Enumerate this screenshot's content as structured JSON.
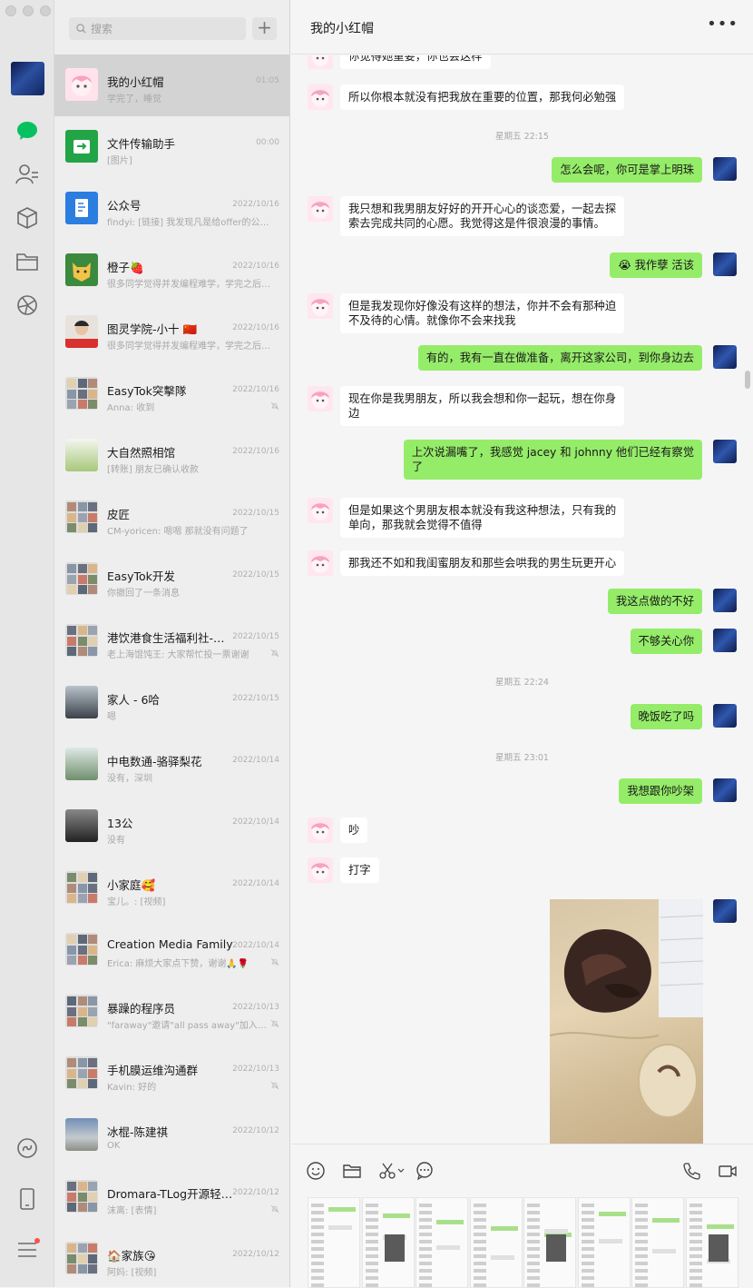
{
  "search": {
    "placeholder": "搜索"
  },
  "chats": [
    {
      "name": "我的小红帽",
      "time": "01:05",
      "preview": "学完了，睡觉",
      "selected": true,
      "muted": false,
      "avatar": "pink-girl"
    },
    {
      "name": "文件传输助手",
      "time": "00:00",
      "preview": "[图片]",
      "muted": false,
      "avatar": "file-transfer"
    },
    {
      "name": "公众号",
      "time": "2022/10/16",
      "preview": "findyi: [链接] 我发现凡是给offer的公司,...",
      "muted": false,
      "avatar": "official-account"
    },
    {
      "name": "橙子🍓",
      "time": "2022/10/16",
      "preview": "很多同学觉得并发编程难学，学完之后工作...",
      "muted": false,
      "avatar": "tomcat"
    },
    {
      "name": "图灵学院-小十 🇨🇳",
      "time": "2022/10/16",
      "preview": "很多同学觉得并发编程难学，学完之后工作...",
      "muted": false,
      "avatar": "person-red"
    },
    {
      "name": "EasyTok突擊隊",
      "time": "2022/10/16",
      "preview": "Anna: 收到",
      "muted": true,
      "avatar": "group"
    },
    {
      "name": "大自然照相馆",
      "time": "2022/10/16",
      "preview": "[转账] 朋友已确认收款",
      "muted": false,
      "avatar": "plant"
    },
    {
      "name": "皮匠",
      "time": "2022/10/15",
      "preview": "CM-yoricen: 嗯嗯  那就没有问题了",
      "muted": false,
      "avatar": "group"
    },
    {
      "name": "EasyTok开发",
      "time": "2022/10/15",
      "preview": "你撤回了一条消息",
      "muted": false,
      "avatar": "group"
    },
    {
      "name": "港饮港食生活福利社-尖...",
      "time": "2022/10/15",
      "preview": "老上海馄饨王: 大家帮忙投一票谢谢",
      "muted": true,
      "avatar": "group"
    },
    {
      "name": "家人 - 6哈",
      "time": "2022/10/15",
      "preview": "嗯",
      "muted": false,
      "avatar": "person-glasses"
    },
    {
      "name": "中电数通-骆驿梨花",
      "time": "2022/10/14",
      "preview": "没有，深圳",
      "muted": false,
      "avatar": "landscape"
    },
    {
      "name": "13公",
      "time": "2022/10/14",
      "preview": "没有",
      "muted": false,
      "avatar": "person-dark"
    },
    {
      "name": "小家庭🥰",
      "time": "2022/10/14",
      "preview": "宝儿。: [视频]",
      "muted": false,
      "avatar": "group"
    },
    {
      "name": "Creation Media Family",
      "time": "2022/10/14",
      "preview": "Erica: 麻烦大家点下赞，谢谢🙏🌹",
      "muted": true,
      "avatar": "group"
    },
    {
      "name": "暴躁的程序员",
      "time": "2022/10/13",
      "preview": "\"faraway\"邀请\"all pass away\"加入了群聊",
      "muted": true,
      "avatar": "group"
    },
    {
      "name": "手机膜运维沟通群",
      "time": "2022/10/13",
      "preview": "Kavin: 好的",
      "muted": true,
      "avatar": "group"
    },
    {
      "name": "冰棍-陈建祺",
      "time": "2022/10/12",
      "preview": "OK",
      "muted": false,
      "avatar": "sky"
    },
    {
      "name": "Dromara-TLog开源轻量...",
      "time": "2022/10/12",
      "preview": "沫离: [表情]",
      "muted": true,
      "avatar": "group"
    },
    {
      "name": "🏠家族😘",
      "time": "2022/10/12",
      "preview": "阿妈: [视频]",
      "muted": false,
      "avatar": "group"
    }
  ],
  "conversation": {
    "title": "我的小红帽",
    "more_icon": "ellipsis-icon",
    "messages": [
      {
        "side": "left",
        "text": "你觉得她重要，你也会这样"
      },
      {
        "side": "left",
        "text": "所以你根本就没有把我放在重要的位置，那我何必勉强"
      },
      {
        "side": "time",
        "text": "星期五 22:15"
      },
      {
        "side": "right",
        "text": "怎么会呢，你可是掌上明珠"
      },
      {
        "side": "left",
        "text": "我只想和我男朋友好好的开开心心的谈恋爱，一起去探",
        "text2": "索去完成共同的心愿。我觉得这是件很浪漫的事情。"
      },
      {
        "side": "right",
        "text": "😭 我作孽 活该"
      },
      {
        "side": "left",
        "text": "但是我发现你好像没有这样的想法，你并不会有那种迫",
        "text2": "不及待的心情。就像你不会来找我"
      },
      {
        "side": "right",
        "text": "有的，我有一直在做准备，离开这家公司，到你身边去"
      },
      {
        "side": "left",
        "text": "现在你是我男朋友，所以我会想和你一起玩，想在你身",
        "text2": "边"
      },
      {
        "side": "right",
        "text": "上次说漏嘴了，我感觉 jacey 和 johnny 他们已经有察觉",
        "text2": "了"
      },
      {
        "side": "left",
        "text": "但是如果这个男朋友根本就没有我这种想法，只有我的",
        "text2": "单向，那我就会觉得不值得"
      },
      {
        "side": "left",
        "text": "那我还不如和我闺蜜朋友和那些会哄我的男生玩更开心"
      },
      {
        "side": "right",
        "text": "我这点做的不好"
      },
      {
        "side": "right",
        "text": "不够关心你"
      },
      {
        "side": "time",
        "text": "星期五 22:24"
      },
      {
        "side": "right",
        "text": "晚饭吃了吗"
      },
      {
        "side": "time",
        "text": "星期五 23:01"
      },
      {
        "side": "right",
        "text": "我想跟你吵架"
      },
      {
        "side": "left",
        "text": "吵"
      },
      {
        "side": "left",
        "text": "打字"
      },
      {
        "side": "right",
        "image": "food-photo"
      }
    ]
  },
  "toolbar": [
    "emoji-icon",
    "folder-icon",
    "scissors-icon",
    "chat-bubble-icon",
    "phone-icon",
    "video-icon"
  ],
  "nav_icons": [
    "chat-icon",
    "contacts-icon",
    "cube-icon",
    "folder-icon",
    "moments-icon",
    "mini-program-icon",
    "phone-icon",
    "menu-icon"
  ],
  "colors": {
    "accent": "#07c160",
    "bubble_self": "#95ec69",
    "nav_bg": "#e6e6e6",
    "list_bg": "#eeeeee",
    "selected": "#d3d3d3"
  }
}
